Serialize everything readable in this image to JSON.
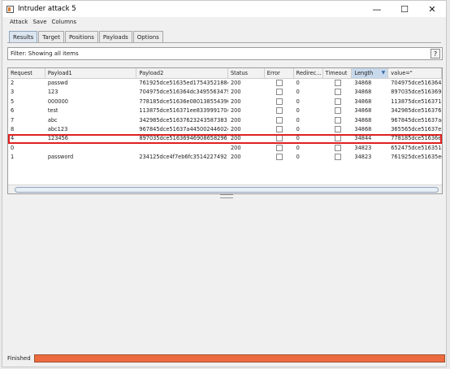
{
  "window": {
    "title": "Intruder attack 5",
    "minimize_glyph": "—",
    "maximize_glyph": "☐",
    "close_glyph": "✕"
  },
  "menu": [
    "Attack",
    "Save",
    "Columns"
  ],
  "tabs": [
    "Results",
    "Target",
    "Positions",
    "Payloads",
    "Options"
  ],
  "filter": {
    "text": "Filter: Showing all items",
    "help_label": "?"
  },
  "table": {
    "columns": [
      "Request",
      "Payload1",
      "Payload2",
      "Status",
      "Error",
      "Redirec...",
      "Timeout",
      "Length",
      "value=\""
    ],
    "sorted_column": "Length",
    "rows": [
      {
        "request": "2",
        "payload1": "passwd",
        "payload2": "761925dce51635ed17543521884",
        "status": "200",
        "redirect": "0",
        "length": "34868",
        "value": "704975dce516364dc"
      },
      {
        "request": "3",
        "payload1": "123",
        "payload2": "704975dce516364dc3495563479",
        "status": "200",
        "redirect": "0",
        "length": "34868",
        "value": "897035dce5163694€"
      },
      {
        "request": "5",
        "payload1": "000000",
        "payload2": "778185dce51636e080138554396",
        "status": "200",
        "redirect": "0",
        "length": "34868",
        "value": "113875dce516371ee"
      },
      {
        "request": "6",
        "payload1": "test",
        "payload2": "113875dce516371ee8339991704",
        "status": "200",
        "redirect": "0",
        "length": "34868",
        "value": "342985dce5163762"
      },
      {
        "request": "7",
        "payload1": "abc",
        "payload2": "342985dce51637623243587383",
        "status": "200",
        "redirect": "0",
        "length": "34868",
        "value": "967845dce51637a4"
      },
      {
        "request": "8",
        "payload1": "abc123",
        "payload2": "967845dce51637a445002446024",
        "status": "200",
        "redirect": "0",
        "length": "34868",
        "value": "365565dce51637e5"
      },
      {
        "request": "4",
        "payload1": "123456",
        "payload2": "897035dce51636946908658296",
        "status": "200",
        "redirect": "0",
        "length": "34844",
        "value": "778185dce51636e08",
        "highlighted": true
      },
      {
        "request": "0",
        "payload1": "",
        "payload2": "",
        "status": "200",
        "redirect": "0",
        "length": "34823",
        "value": "652475dce516351cc"
      },
      {
        "request": "1",
        "payload1": "password",
        "payload2": "234125dce4f7eb6fc3514227492",
        "status": "200",
        "redirect": "0",
        "length": "34823",
        "value": "761925dce51635ed1"
      }
    ]
  },
  "status": {
    "text": "Finished",
    "progress": 1.0
  }
}
